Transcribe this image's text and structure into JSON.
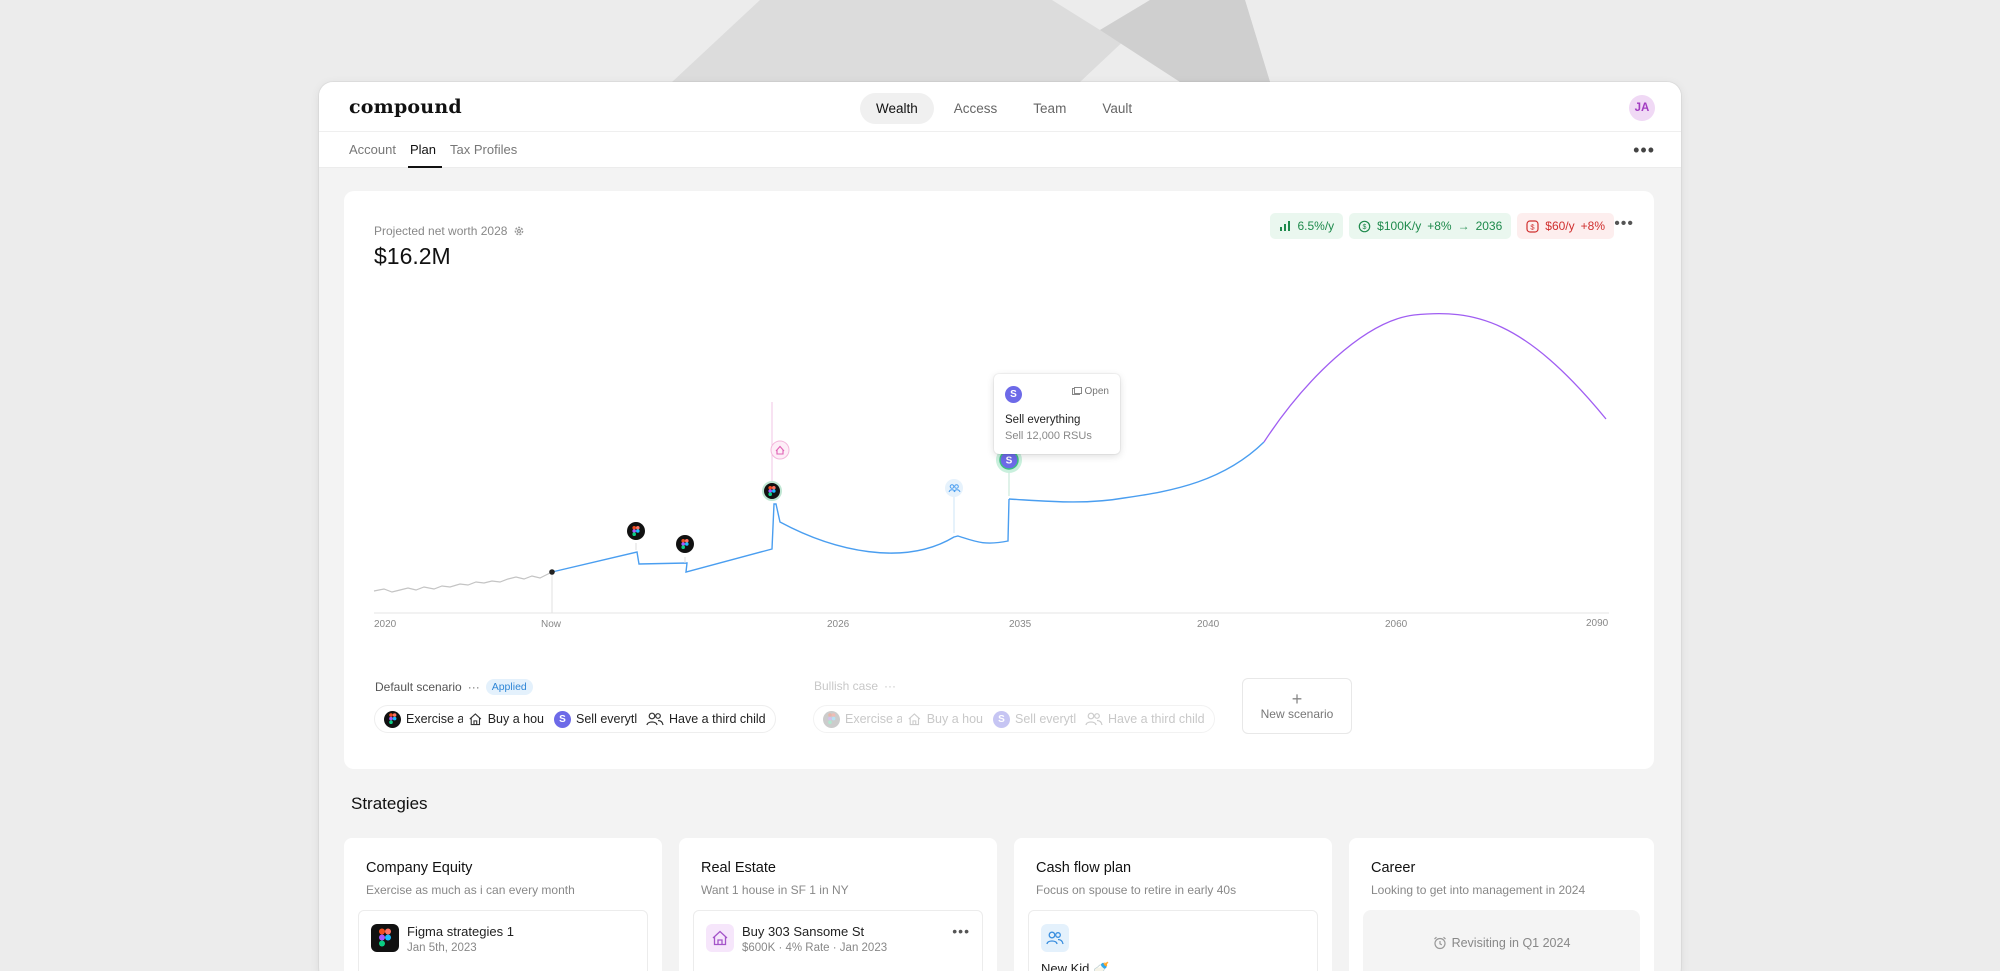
{
  "app": {
    "logo": "compound",
    "avatar_initials": "JA"
  },
  "main_nav": [
    {
      "label": "Wealth",
      "active": true
    },
    {
      "label": "Access",
      "active": false
    },
    {
      "label": "Team",
      "active": false
    },
    {
      "label": "Vault",
      "active": false
    }
  ],
  "sub_tabs": [
    {
      "label": "Account",
      "active": false
    },
    {
      "label": "Plan",
      "active": true
    },
    {
      "label": "Tax Profiles",
      "active": false
    }
  ],
  "projection": {
    "label": "Projected net worth 2028",
    "value": "$16.2M",
    "pills": {
      "growth": "6.5%/y",
      "income": "$100K/y",
      "income_change": "+8%",
      "income_until": "2036",
      "expense": "$60/y",
      "expense_change": "+8%"
    }
  },
  "tooltip": {
    "icon_letter": "S",
    "open_label": "Open",
    "title": "Sell everything",
    "subtitle": "Sell 12,000 RSUs"
  },
  "chart_data": {
    "type": "line",
    "x_tick_labels": [
      "2020",
      "Now",
      "2026",
      "2035",
      "2040",
      "2060",
      "2090"
    ],
    "series": [],
    "events": [
      {
        "icon": "figma-icon"
      },
      {
        "icon": "figma-icon"
      },
      {
        "icon": "figma-icon"
      },
      {
        "icon": "house-icon"
      },
      {
        "icon": "people-icon"
      },
      {
        "icon": "stock-s-icon"
      }
    ],
    "colors": {
      "history": "#c4c4c4",
      "projection": "#4a9ef0",
      "forecast": "#a05ef2"
    },
    "grid": false,
    "legend": "none"
  },
  "scenarios": {
    "default": {
      "label": "Default scenario",
      "badge": "Applied",
      "chips": [
        "Exercise a",
        "Buy a hou",
        "Sell everytl",
        "Have a third child"
      ]
    },
    "bullish": {
      "label": "Bullish case",
      "chips": [
        "Exercise a",
        "Buy a hou",
        "Sell everytl",
        "Have a third child"
      ]
    },
    "new_label": "New scenario"
  },
  "strategies": {
    "title": "Strategies",
    "cards": [
      {
        "title": "Company Equity",
        "subtitle": "Exercise as much as i can every month",
        "item_title": "Figma strategies 1",
        "item_sub": "Jan 5th, 2023"
      },
      {
        "title": "Real Estate",
        "subtitle": "Want 1 house in SF 1 in NY",
        "item_title": "Buy 303 Sansome St",
        "item_sub": "$600K · 4% Rate · Jan 2023"
      },
      {
        "title": "Cash flow plan",
        "subtitle": "Focus on spouse to retire in early 40s",
        "item_title": "New Kid 🍼",
        "item_sub": ""
      },
      {
        "title": "Career",
        "subtitle": "Looking to get into management in 2024",
        "revisit": "Revisiting in Q1 2024"
      }
    ]
  }
}
